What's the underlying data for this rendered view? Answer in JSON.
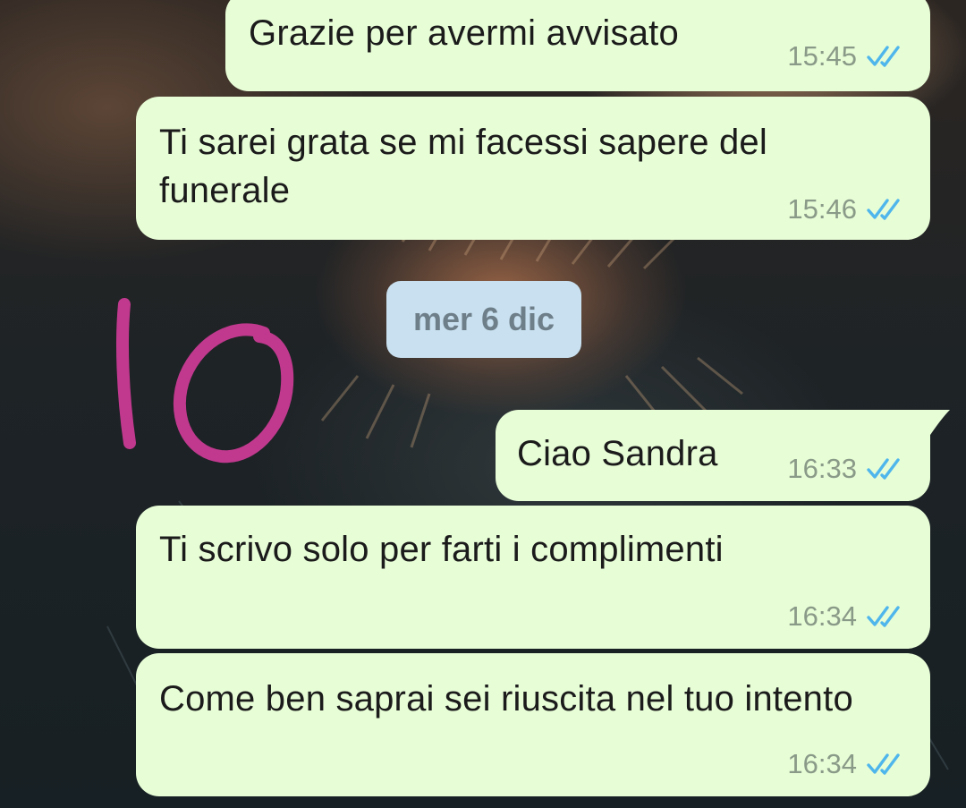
{
  "chat": {
    "messages": [
      {
        "text": "Grazie per avermi avvisato",
        "time": "15:45",
        "status_icon": "double-check-blue"
      },
      {
        "text": "Ti sarei grata se mi facessi sapere del funerale",
        "time": "15:46",
        "status_icon": "double-check-blue"
      },
      {
        "text": "Ciao Sandra",
        "time": "16:33",
        "status_icon": "double-check-blue"
      },
      {
        "text": "Ti scrivo solo per farti i complimenti",
        "time": "16:34",
        "status_icon": "double-check-blue"
      },
      {
        "text": "Come ben saprai sei riuscita nel tuo intento",
        "time": "16:34",
        "status_icon": "double-check-blue"
      }
    ],
    "date_separator": "mer 6 dic"
  },
  "colors": {
    "bubble_bg": "#e7fdd6",
    "tick_blue": "#4fb6ec",
    "date_chip_bg": "#c8e0ef",
    "annotation_magenta": "#c0398e"
  },
  "annotation": {
    "content": "handwritten number in magenta marker"
  }
}
